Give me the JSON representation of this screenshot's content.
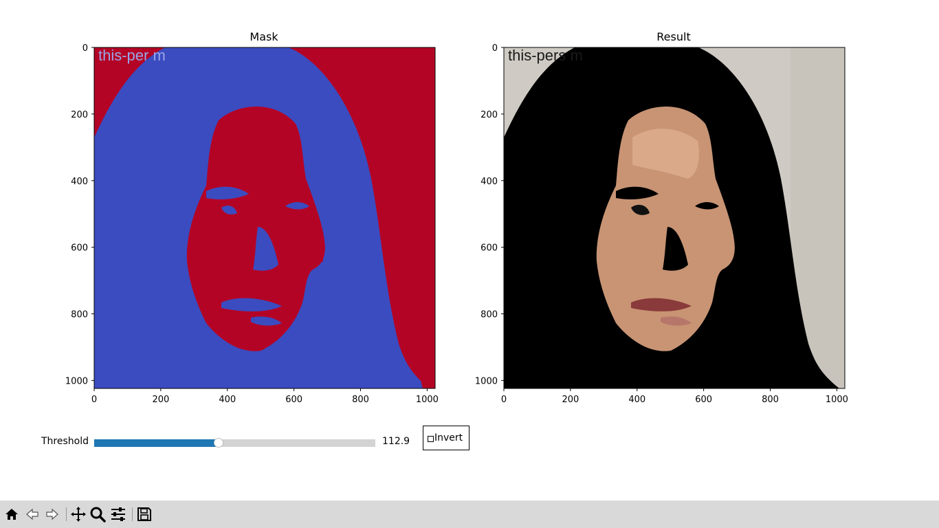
{
  "figure": {
    "mask_title": "Mask",
    "result_title": "Result",
    "watermark_mask": "this-per                              m",
    "watermark_result": "this-pers                            m",
    "x_ticks": [
      "0",
      "200",
      "400",
      "600",
      "800",
      "1000"
    ],
    "y_ticks": [
      "0",
      "200",
      "400",
      "600",
      "800",
      "1000"
    ],
    "colors": {
      "mask_high": "#b40426",
      "mask_low": "#3b4cc0",
      "result_bg": "#000000",
      "result_wall": "#cfcbc4",
      "skin": "#c89474"
    }
  },
  "controls": {
    "threshold_label": "Threshold",
    "threshold_value": "112.9",
    "threshold_fraction": 0.443,
    "invert_label": "Invert",
    "invert_checked": false
  },
  "toolbar": {
    "buttons": [
      "home-icon",
      "back-icon",
      "forward-icon",
      "pan-icon",
      "zoom-icon",
      "configure-subplots-icon",
      "save-icon"
    ]
  }
}
